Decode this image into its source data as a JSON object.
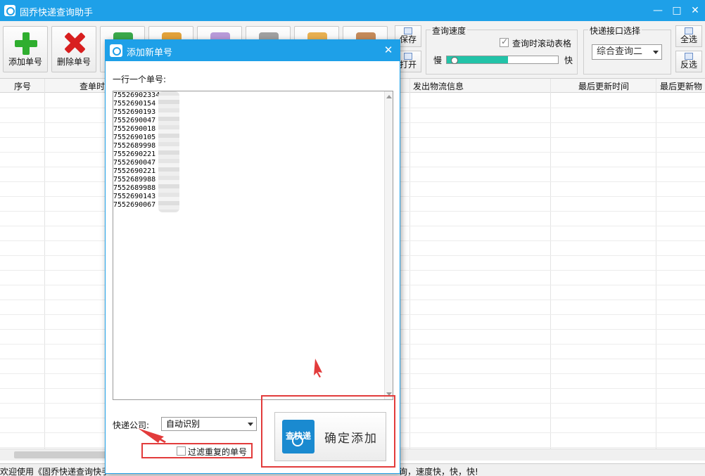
{
  "app": {
    "title": "固乔快递查询助手",
    "min_glyph": "—",
    "max_glyph": "□",
    "close_glyph": "✕"
  },
  "toolbar": {
    "add_label": "添加单号",
    "delete_label": "删除单号",
    "save_label": "保存",
    "open_label": "打开",
    "speed_group": {
      "title": "查询速度",
      "scroll_checkbox_label": "查询时滚动表格",
      "scroll_checked": true,
      "slow_label": "慢",
      "fast_label": "快",
      "speed_level": 0.55
    },
    "api_group": {
      "title": "快递接口选择",
      "selected": "综合查询二"
    },
    "select_all_label": "全选",
    "invert_label": "反选"
  },
  "table": {
    "columns": [
      "序号",
      "查单时",
      "发出物流信息",
      "最后更新时间",
      "最后更新物"
    ]
  },
  "status": {
    "left_text": "欢迎使用《固乔快递查询快手",
    "right_text": "询，速度快，快，快!"
  },
  "dialog": {
    "title": "添加新单号",
    "close_glyph": "✕",
    "hint": "一行一个单号:",
    "numbers": [
      "7552690233416",
      "7552690154",
      "7552690193",
      "7552690047",
      "7552690018",
      "7552690105",
      "7552689998",
      "7552690221",
      "7552690047",
      "7552690221",
      "7552689988",
      "7552689988",
      "7552690143",
      "7552690067"
    ],
    "company_label": "快递公司:",
    "company_selected": "自动识别",
    "filter_label": "过滤重复的单号",
    "filter_checked": false,
    "confirm_logo_text": "查快递",
    "confirm_label": "确定添加"
  },
  "colors": {
    "accent": "#1ea0e8",
    "highlight": "#e23b3b",
    "slider_fill": "#22c3a8"
  }
}
